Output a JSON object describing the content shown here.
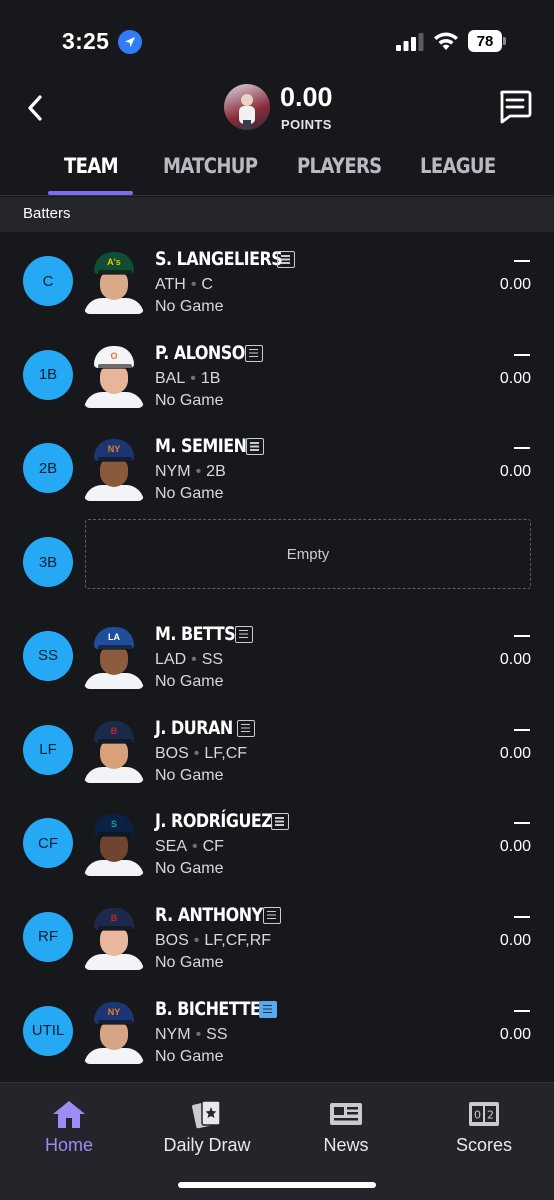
{
  "status_bar": {
    "time": "3:25",
    "battery": "78"
  },
  "header": {
    "points_value": "0.00",
    "points_label": "POINTS"
  },
  "tabs": [
    {
      "label": "TEAM",
      "active": true
    },
    {
      "label": "MATCHUP",
      "active": false
    },
    {
      "label": "PLAYERS",
      "active": false
    },
    {
      "label": "LEAGUE",
      "active": false
    }
  ],
  "section": {
    "title": "Batters"
  },
  "roster": [
    {
      "pos": "C",
      "name": "S. LANGELIERS",
      "team": "ATH",
      "positions": "C",
      "game": "No Game",
      "stat": "—",
      "points": "0.00",
      "cap_color": "#0f4d34",
      "logo": "A's",
      "logo_color": "#f2c200",
      "skin": "#d9a98a"
    },
    {
      "pos": "1B",
      "name": "P. ALONSO",
      "team": "BAL",
      "positions": "1B",
      "game": "No Game",
      "stat": "—",
      "points": "0.00",
      "cap_color": "#f4f4f4",
      "logo": "O",
      "logo_color": "#ed6f2e",
      "skin": "#e6b59a"
    },
    {
      "pos": "2B",
      "name": "M. SEMIEN",
      "team": "NYM",
      "positions": "2B",
      "game": "No Game",
      "stat": "—",
      "points": "0.00",
      "cap_color": "#1b3672",
      "logo": "NY",
      "logo_color": "#f07a2a",
      "skin": "#8b5a3c"
    },
    {
      "pos": "3B",
      "empty": true,
      "empty_label": "Empty"
    },
    {
      "pos": "SS",
      "name": "M. BETTS",
      "team": "LAD",
      "positions": "SS",
      "game": "No Game",
      "stat": "—",
      "points": "0.00",
      "cap_color": "#1f4f9c",
      "logo": "LA",
      "logo_color": "#ffffff",
      "skin": "#8d5c3f"
    },
    {
      "pos": "LF",
      "name": "J. DURAN",
      "team": "BOS",
      "positions": "LF,CF",
      "game": "No Game",
      "stat": "—",
      "points": "0.00",
      "cap_color": "#1b2a4a",
      "logo": "B",
      "logo_color": "#c8202f",
      "skin": "#d9a07c"
    },
    {
      "pos": "CF",
      "name": "J. RODRÍGUEZ",
      "team": "SEA",
      "positions": "CF",
      "game": "No Game",
      "stat": "—",
      "points": "0.00",
      "cap_color": "#0b2144",
      "logo": "S",
      "logo_color": "#0fa39a",
      "skin": "#6e4530"
    },
    {
      "pos": "RF",
      "name": "R. ANTHONY",
      "team": "BOS",
      "positions": "LF,CF,RF",
      "game": "No Game",
      "stat": "—",
      "points": "0.00",
      "cap_color": "#1b2a4a",
      "logo": "B",
      "logo_color": "#c8202f",
      "skin": "#e8b79e"
    },
    {
      "pos": "UTIL",
      "name": "B. BICHETTE",
      "team": "NYM",
      "positions": "SS",
      "game": "No Game",
      "stat": "—",
      "points": "0.00",
      "cap_color": "#1b3672",
      "logo": "NY",
      "logo_color": "#f07a2a",
      "skin": "#d6a583",
      "note_highlight": true
    }
  ],
  "bottom_nav": [
    {
      "label": "Home",
      "icon": "home-icon",
      "active": true
    },
    {
      "label": "Daily Draw",
      "icon": "cards-icon",
      "active": false
    },
    {
      "label": "News",
      "icon": "newspaper-icon",
      "active": false
    },
    {
      "label": "Scores",
      "icon": "scoreboard-icon",
      "active": false
    }
  ],
  "colors": {
    "accent": "#7c6cf2",
    "position_badge": "#25a9f4",
    "background": "#16181c"
  }
}
